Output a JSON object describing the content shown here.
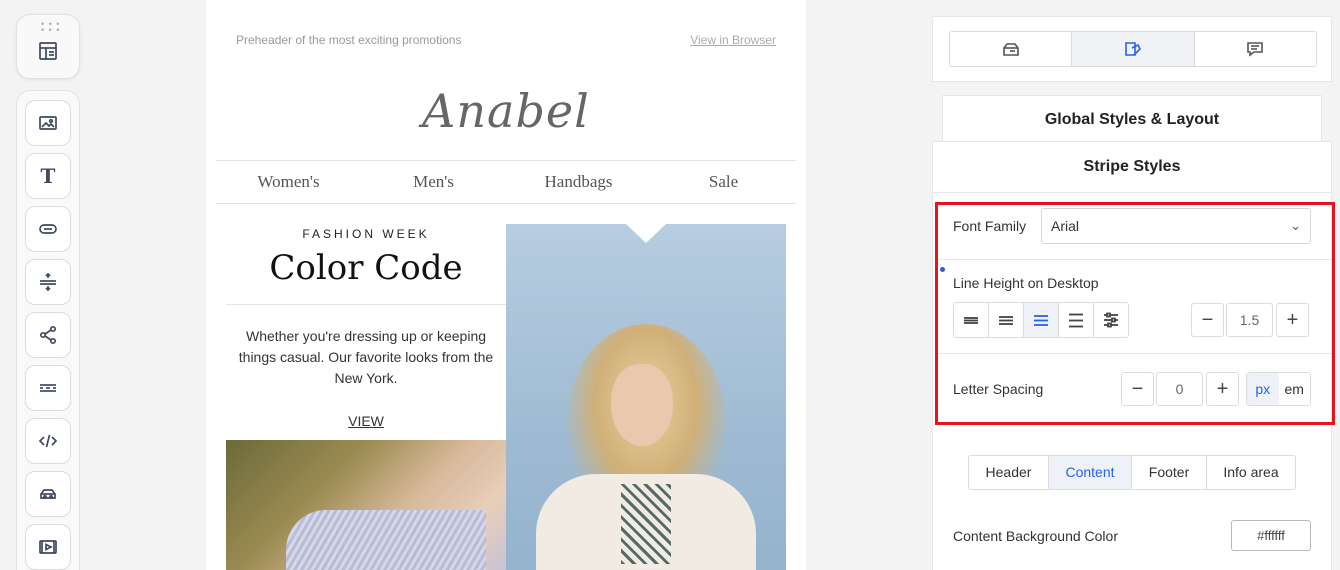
{
  "toolbar": {
    "top_icon": "layout-icon",
    "tools": [
      "image-icon",
      "text-icon",
      "button-icon",
      "spacer-icon",
      "social-icon",
      "divider-icon",
      "html-code-icon",
      "banner-icon",
      "video-icon"
    ],
    "text_tool_glyph": "T"
  },
  "email": {
    "preheader": "Preheader of the most exciting promotions",
    "view_in_browser": "View in Browser",
    "logo": "Anabel",
    "nav": [
      "Women's",
      "Men's",
      "Handbags",
      "Sale"
    ],
    "kicker": "FASHION WEEK",
    "headline": "Color Code",
    "body": "Whether you're dressing up or keeping things casual. Our favorite looks from the New York.",
    "cta": "VIEW"
  },
  "panel": {
    "icon_tabs": [
      "structure-icon",
      "style-icon",
      "comment-icon"
    ],
    "active_icon_tab": 1,
    "global_styles_label": "Global Styles & Layout",
    "stripe_styles_label": "Stripe Styles",
    "font_family_label": "Font Family",
    "font_family_value": "Arial",
    "line_height_label": "Line Height on Desktop",
    "line_height_options": [
      "line-height-compact-icon",
      "line-height-small-icon",
      "line-height-medium-icon",
      "line-height-large-icon",
      "line-height-custom-icon"
    ],
    "line_height_active": 2,
    "line_height_value": "1.5",
    "letter_spacing_label": "Letter Spacing",
    "letter_spacing_value": "0",
    "units": [
      "px",
      "em"
    ],
    "active_unit": "px",
    "minus": "−",
    "plus": "+",
    "section_tabs": [
      "Header",
      "Content",
      "Footer",
      "Info area"
    ],
    "active_section_tab": "Content",
    "content_bg_label": "Content Background Color",
    "content_bg_value": "#ffffff"
  },
  "colors": {
    "accent": "#2563eb",
    "highlight": "#e3141c"
  }
}
